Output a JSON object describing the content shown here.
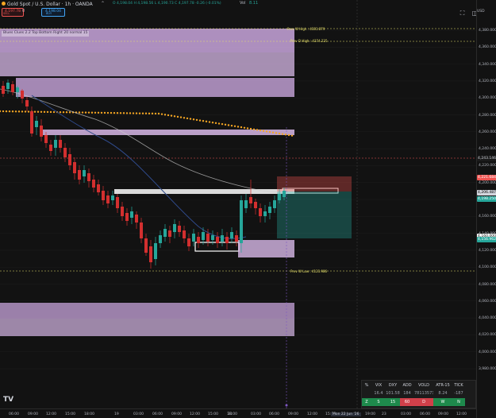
{
  "header": {
    "symbol": "Gold Spot / U.S. Dollar · 1h · OANDA",
    "sell_price": "4,197.78",
    "sell_label": "SELL",
    "spread": "0",
    "buy_price": "4,198.04",
    "buy_label": "BUY",
    "ohlc": "O 4,198.04  H 4,198.56  L 4,190.73  C 4,197.78  -0.26 (-0.01%)",
    "vol_label": "Vol",
    "vol_value": "8.11"
  },
  "indicator_label": "Blues Clues 2.2 Top Bottom Right 20 normal 15",
  "toolbar": {
    "fullscreen_icon": "fullscreen-icon",
    "screenshot_icon": "camera-icon",
    "more_icon": "dots-icon"
  },
  "price_axis": {
    "currency": "USD",
    "labels": [
      "4,380.000",
      "4,360.000",
      "4,340.000",
      "4,320.000",
      "4,300.000",
      "4,280.000",
      "4,260.000",
      "4,240.000",
      "4,220.000",
      "4,200.000",
      "4,180.000",
      "4,160.000",
      "4,140.000",
      "4,120.000",
      "4,100.000",
      "4,080.000",
      "4,060.000",
      "4,040.000",
      "4,020.000",
      "4,000.000",
      "3,980.000"
    ],
    "tags": [
      {
        "text": "4,243.146",
        "color": "#1b1b1b",
        "fg": "#d1d4dc"
      },
      {
        "text": "4,221.684",
        "color": "#ef5350",
        "fg": "#ffffff"
      },
      {
        "text": "4,206.487",
        "color": "#d1d4dc",
        "fg": "#000000"
      },
      {
        "text": "4,198.250",
        "color": "#26a69a",
        "fg": "#ffffff"
      },
      {
        "text": "4,160.000",
        "color": "#ffffff",
        "fg": "#000000"
      },
      {
        "text": "4,156.962",
        "color": "#26a69a",
        "fg": "#ffffff"
      }
    ]
  },
  "level_labels": {
    "prev_w_high": "Prev W High : 4381.879",
    "prev_d_high": "Prev D High : 4374.225",
    "prev_w_low": "Prev W Low : 4123.986"
  },
  "time_axis": {
    "labels": [
      "06:00",
      "09:00",
      "12:00",
      "15:00",
      "18:00",
      "19",
      "03:00",
      "06:00",
      "09:00",
      "12:00",
      "15:00",
      "18:00",
      "21",
      "03:00",
      "06:00",
      "09:00",
      "12:00",
      "15:00",
      "Mon 22 Jun '26",
      "19:00",
      "23",
      "03:00",
      "06:00",
      "09:00",
      "12:00"
    ]
  },
  "watchlist": {
    "headers": [
      "%",
      "VIX",
      "DXY",
      "ADD",
      "VOLD",
      "ATR-15",
      "TICK"
    ],
    "row1": [
      "",
      "16.4",
      "101.58",
      "184",
      "781135736",
      "8.24",
      "-187"
    ],
    "row2": [
      "Z",
      "S",
      "15",
      "60",
      "D",
      "W",
      "N"
    ],
    "colors": {
      "green": "#1e8a4c",
      "red": "#d0404a",
      "dark": "#1b1b1b"
    }
  },
  "logo_text": "TV",
  "colors": {
    "up": "#26a69a",
    "down": "#ef5350",
    "zone": "#c8a0dc",
    "gold_dots": "#f5a623"
  }
}
